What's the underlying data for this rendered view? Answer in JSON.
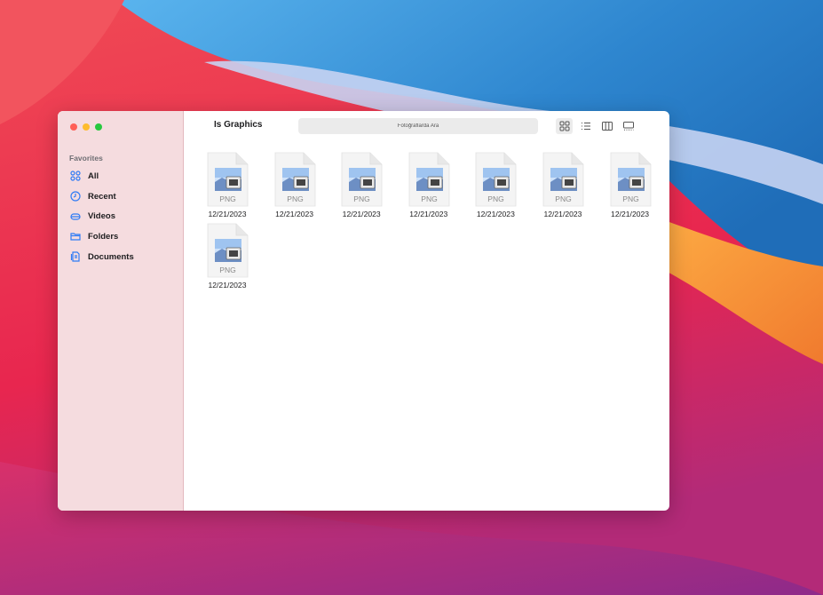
{
  "window": {
    "title": "Is Graphics",
    "search": {
      "placeholder": "Fotoğraflarda Ara",
      "value": ""
    }
  },
  "sidebar": {
    "section_title": "Favorites",
    "items": [
      {
        "label": "All",
        "icon": "grid-icon",
        "selected": true
      },
      {
        "label": "Recent",
        "icon": "clock-icon"
      },
      {
        "label": "Videos",
        "icon": "videos-icon"
      },
      {
        "label": "Folders",
        "icon": "folder-icon"
      },
      {
        "label": "Documents",
        "icon": "documents-icon"
      }
    ]
  },
  "view_modes": [
    {
      "icon": "grid-view-icon",
      "active": true
    },
    {
      "icon": "list-view-icon"
    },
    {
      "icon": "columns-view-icon"
    },
    {
      "icon": "gallery-view-icon"
    }
  ],
  "files": [
    {
      "type": "PNG",
      "date": "12/21/2023"
    },
    {
      "type": "PNG",
      "date": "12/21/2023"
    },
    {
      "type": "PNG",
      "date": "12/21/2023"
    },
    {
      "type": "PNG",
      "date": "12/21/2023"
    },
    {
      "type": "PNG",
      "date": "12/21/2023"
    },
    {
      "type": "PNG",
      "date": "12/21/2023"
    },
    {
      "type": "PNG",
      "date": "12/21/2023"
    },
    {
      "type": "PNG",
      "date": "12/21/2023"
    }
  ],
  "colors": {
    "accent": "#2f7bf5",
    "sidebar_bg": "#f5dcdf"
  }
}
